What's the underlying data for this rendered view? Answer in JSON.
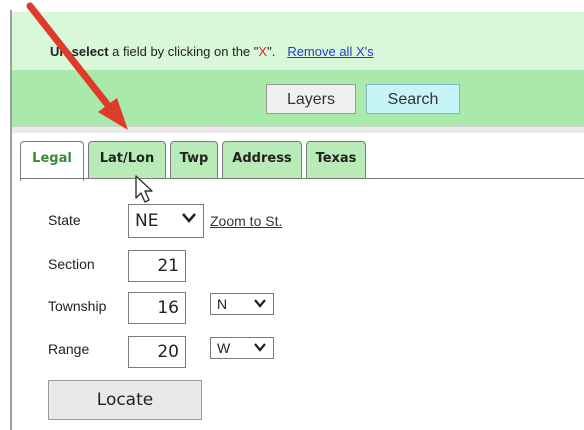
{
  "notice": {
    "text_bold": "Un-select",
    "text_mid": " a field by clicking on the \"",
    "text_x": "X",
    "text_end": "\".",
    "remove_link": "Remove all X's"
  },
  "toolbar": {
    "layers_label": "Layers",
    "search_label": "Search"
  },
  "tabs": [
    {
      "label": "Legal",
      "active": true
    },
    {
      "label": "Lat/Lon"
    },
    {
      "label": "Twp"
    },
    {
      "label": "Address"
    },
    {
      "label": "Texas"
    }
  ],
  "form": {
    "state_label": "State",
    "state_value": "NE",
    "zoom_link": "Zoom to St.",
    "section_label": "Section",
    "section_value": "21",
    "township_label": "Township",
    "township_value": "16",
    "township_dir": "N",
    "range_label": "Range",
    "range_value": "20",
    "range_dir": "W",
    "locate_label": "Locate"
  },
  "colors": {
    "notice_bg": "#d9f7d9",
    "toolbar_bg": "#a9e9a9",
    "tab_bg": "#b8ebb8",
    "search_bg": "#c6f4f7",
    "arrow": "#e03a2a"
  }
}
